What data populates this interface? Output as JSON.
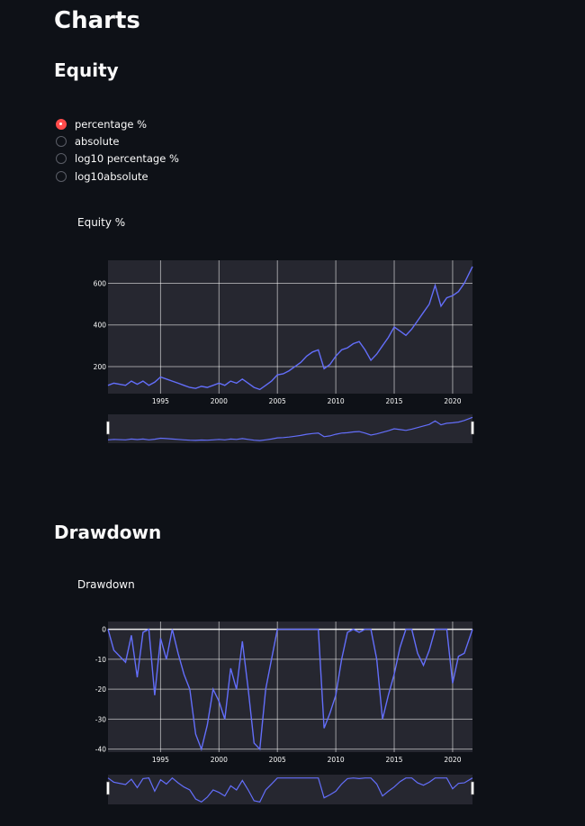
{
  "page": {
    "title": "Charts"
  },
  "equity_section": {
    "heading": "Equity",
    "radio_options": [
      "percentage %",
      "absolute",
      "log10 percentage %",
      "log10absolute"
    ],
    "selected_index": 0
  },
  "drawdown_section": {
    "heading": "Drawdown"
  },
  "colors": {
    "line": "#636efa",
    "plot_bg": "#262730",
    "page_bg": "#0e1117",
    "grid": "#ffffff",
    "accent": "#ff4b4b"
  },
  "chart_data": [
    {
      "type": "line",
      "title": "Equity %",
      "x_ticks": [
        1995,
        2000,
        2005,
        2010,
        2015,
        2020
      ],
      "y_ticks": [
        200,
        400,
        600
      ],
      "xlim": [
        1990.5,
        2021.7
      ],
      "ylim": [
        70,
        710
      ],
      "range_slider": true,
      "x": [
        1990.5,
        1991,
        1992,
        1992.5,
        1993,
        1993.5,
        1994,
        1994.5,
        1995,
        1995.5,
        1996,
        1996.5,
        1997,
        1997.5,
        1998,
        1998.5,
        1999,
        1999.5,
        2000,
        2000.5,
        2001,
        2001.5,
        2002,
        2002.5,
        2003,
        2003.5,
        2004,
        2004.5,
        2005,
        2005.5,
        2006,
        2006.5,
        2007,
        2007.5,
        2008,
        2008.5,
        2009,
        2009.5,
        2010,
        2010.5,
        2011,
        2011.5,
        2012,
        2012.5,
        2013,
        2013.5,
        2014,
        2014.5,
        2015,
        2015.5,
        2016,
        2016.5,
        2017,
        2017.5,
        2018,
        2018.5,
        2019,
        2019.5,
        2020,
        2020.5,
        2021,
        2021.7
      ],
      "y": [
        110,
        120,
        110,
        130,
        115,
        130,
        110,
        125,
        150,
        140,
        130,
        120,
        110,
        100,
        95,
        105,
        100,
        110,
        120,
        110,
        130,
        120,
        140,
        120,
        100,
        90,
        110,
        130,
        160,
        165,
        180,
        200,
        220,
        250,
        270,
        280,
        190,
        210,
        250,
        280,
        290,
        310,
        320,
        280,
        230,
        260,
        300,
        340,
        390,
        370,
        350,
        380,
        420,
        460,
        500,
        590,
        490,
        530,
        540,
        560,
        600,
        680
      ]
    },
    {
      "type": "line",
      "title": "Drawdown",
      "x_ticks": [
        1995,
        2000,
        2005,
        2010,
        2015,
        2020
      ],
      "y_ticks": [
        0,
        -10,
        -20,
        -30,
        -40
      ],
      "xlim": [
        1990.5,
        2021.7
      ],
      "ylim": [
        -41,
        2.6
      ],
      "range_slider": true,
      "x": [
        1990.5,
        1991,
        1992,
        1992.5,
        1993,
        1993.5,
        1994,
        1994.5,
        1995,
        1995.5,
        1996,
        1996.5,
        1997,
        1997.5,
        1998,
        1998.5,
        1999,
        1999.5,
        2000,
        2000.5,
        2001,
        2001.5,
        2002,
        2002.5,
        2003,
        2003.5,
        2004,
        2004.5,
        2005,
        2006,
        2007,
        2008,
        2008.5,
        2009,
        2009.5,
        2010,
        2010.5,
        2011,
        2011.5,
        2012,
        2012.5,
        2013,
        2013.5,
        2014,
        2014.5,
        2015,
        2015.5,
        2016,
        2016.5,
        2017,
        2017.5,
        2018,
        2018.5,
        2019,
        2019.5,
        2020,
        2020.5,
        2021,
        2021.7
      ],
      "y": [
        0,
        -7,
        -11,
        -2,
        -16,
        -1,
        0,
        -22,
        -3,
        -10,
        0,
        -8,
        -15,
        -20,
        -35,
        -40,
        -32,
        -20,
        -24,
        -30,
        -13,
        -20,
        -4,
        -20,
        -38,
        -40,
        -20,
        -10,
        0,
        0,
        0,
        0,
        0,
        -33,
        -28,
        -22,
        -10,
        -1,
        0,
        -1,
        0,
        0,
        -10,
        -30,
        -22,
        -15,
        -6,
        0,
        0,
        -8,
        -12,
        -7,
        0,
        0,
        0,
        -18,
        -9,
        -8,
        0
      ]
    }
  ]
}
